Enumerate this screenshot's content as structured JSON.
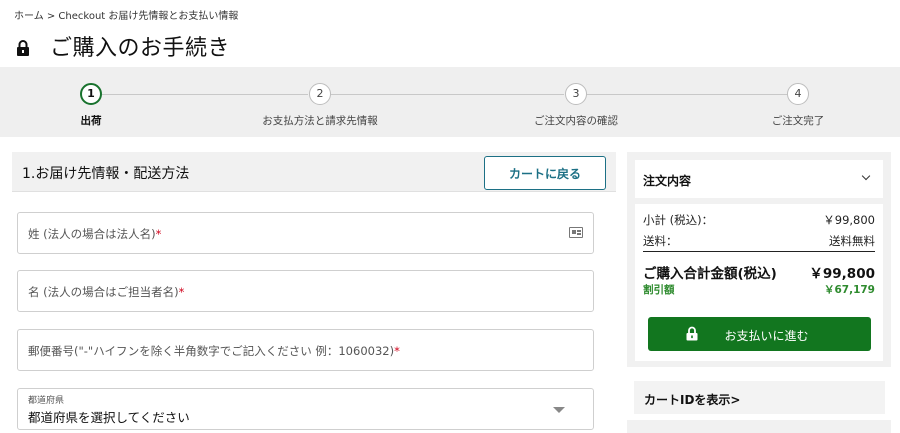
{
  "breadcrumb": "ホーム > Checkout お届け先情報とお支払い情報",
  "header": {
    "title": "ご購入のお手続き",
    "icon": "lock-icon"
  },
  "steps": [
    {
      "num": "1",
      "label": "出荷"
    },
    {
      "num": "2",
      "label": "お支払方法と請求先情報"
    },
    {
      "num": "3",
      "label": "ご注文内容の確認"
    },
    {
      "num": "4",
      "label": "ご注文完了"
    }
  ],
  "active_step": 1,
  "section": {
    "title": "1.お届け先情報・配送方法",
    "back_button": "カートに戻る"
  },
  "form": {
    "last_name": {
      "placeholder": "姓 (法人の場合は法人名)",
      "required": "*"
    },
    "first_name": {
      "placeholder": "名 (法人の場合はご担当者名)",
      "required": "*"
    },
    "postal": {
      "placeholder": "郵便番号(\"-\"ハイフンを除く半角数字でご記入ください 例：1060032)",
      "required": "*"
    },
    "prefecture": {
      "label": "都道府県",
      "value": "都道府県を選択してください"
    }
  },
  "order": {
    "heading": "注文内容",
    "subtotal_label": "小計 (税込)：",
    "subtotal_value": "￥99,800",
    "shipping_label": "送料：",
    "shipping_value": "送料無料",
    "total_label": "ご購入合計金額(税込)",
    "total_value": "￥99,800",
    "discount_label": "割引額",
    "discount_value": "￥67,179",
    "pay_button": "お支払いに進む"
  },
  "cart_id_link": "カートIDを表示>",
  "colors": {
    "accent": "#12761f",
    "active_step": "#18722d",
    "back_button": "#1c7085",
    "required": "#d0021b",
    "discount": "#2e8b2e"
  }
}
